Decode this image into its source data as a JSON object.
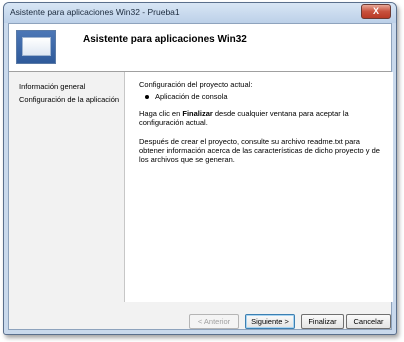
{
  "window": {
    "title": "Asistente para aplicaciones Win32 - Prueba1"
  },
  "header": {
    "title": "Asistente para aplicaciones Win32"
  },
  "nav": {
    "items": [
      {
        "label": "Información general"
      },
      {
        "label": "Configuración de la aplicación"
      }
    ]
  },
  "content": {
    "config_label": "Configuración del proyecto actual:",
    "bullet": "Aplicación de consola",
    "instruction_pre": "Haga clic en ",
    "instruction_bold": "Finalizar",
    "instruction_post": " desde cualquier ventana para aceptar la configuración actual.",
    "info": "Después de crear el proyecto, consulte su archivo readme.txt para obtener información acerca de las características de dicho proyecto y de los archivos que se generan."
  },
  "buttons": {
    "back": "< Anterior",
    "next": "Siguiente >",
    "finish": "Finalizar",
    "cancel": "Cancelar",
    "close": "X"
  },
  "colors": {
    "close_button": "#c8513d",
    "title_bar": "#c9d9ec"
  }
}
